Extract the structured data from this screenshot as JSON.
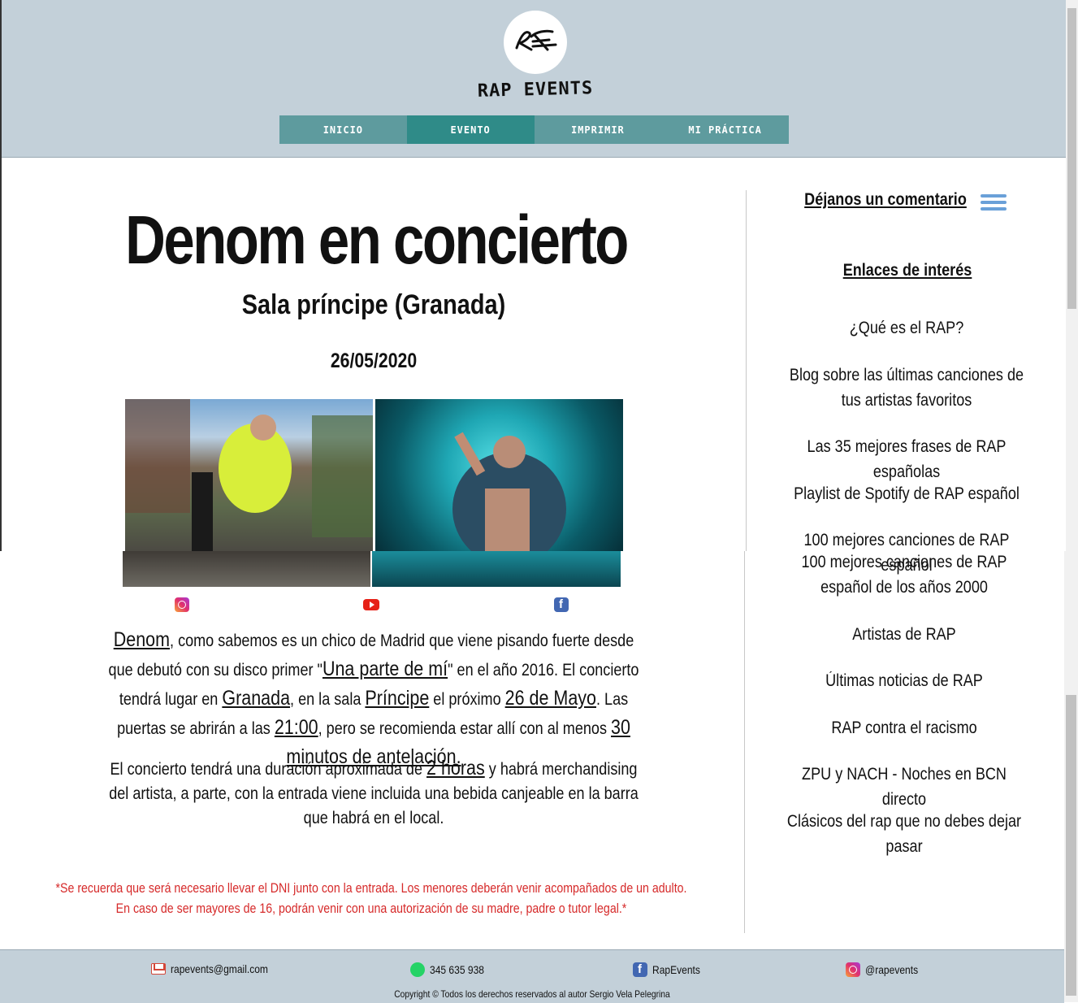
{
  "header": {
    "brand": "RAP EVENTS",
    "nav": [
      "INICIO",
      "EVENTO",
      "IMPRIMIR",
      "MI PRÁCTICA"
    ]
  },
  "event": {
    "title": "Denom en concierto",
    "venue": "Sala príncipe (Granada)",
    "date": "26/05/2020"
  },
  "paragraph1": {
    "artist": "Denom",
    "t1": ", como sabemos es un chico de Madrid que viene pisando fuerte desde que debutó con su disco primer \"",
    "album": "Una parte de mí",
    "t2": "\" en el año 2016. El concierto tendrá lugar en ",
    "city": "Granada",
    "t3": ", en la sala ",
    "hall": "Príncipe",
    "t4": " el próximo ",
    "day": "26 de Mayo",
    "t5": ". Las puertas se abrirán a las ",
    "time": "21:00",
    "t6": ", pero se recomienda estar allí con al menos ",
    "advance": "30 minutos de antelación."
  },
  "paragraph2": {
    "t1": "El concierto tendrá una duración aproximada de ",
    "duration": "2 horas",
    "t2": " y habrá merchandising del artista, a parte, con la entrada viene incluida una bebida canjeable en la barra que habrá en el local."
  },
  "note": "*Se recuerda que será necesario llevar el DNI junto con la entrada. Los menores deberán venir acompañados de un adulto. En caso de ser mayores de 16, podrán venir con una autorización de su madre, padre o tutor legal.*",
  "sidebar": {
    "comment_heading": "Déjanos un comentario",
    "links_heading": "Enlaces de interés",
    "links": [
      "¿Qué es el RAP?",
      "Blog sobre las últimas canciones de tus artistas favoritos",
      "Las 35 mejores frases de RAP españolas",
      "Playlist de Spotify de RAP español",
      "100 mejores canciones de RAP español",
      "100 mejores canciones de RAP español de los años 2000",
      "Artistas de RAP",
      "Últimas noticias de RAP",
      "RAP contra el racismo",
      "ZPU y NACH - Noches en BCN directo",
      "Clásicos del rap que no debes dejar pasar"
    ]
  },
  "footer": {
    "email": "rapevents@gmail.com",
    "phone": "345 635 938",
    "facebook": "RapEvents",
    "instagram": "@rapevents",
    "copyright": "Copyright © Todos los derechos reservados al autor Sergio Vela Pelegrina"
  },
  "icons": [
    "logo-icon",
    "instagram-icon",
    "youtube-icon",
    "facebook-icon",
    "menu-icon",
    "gmail-icon",
    "whatsapp-icon"
  ],
  "colors": {
    "header_bg": "#c3d0d9",
    "nav_bg": "#5e9b9e",
    "nav_active": "#2f8b88",
    "note_red": "#d62a2a",
    "menu_blue": "#6aa0d8"
  }
}
